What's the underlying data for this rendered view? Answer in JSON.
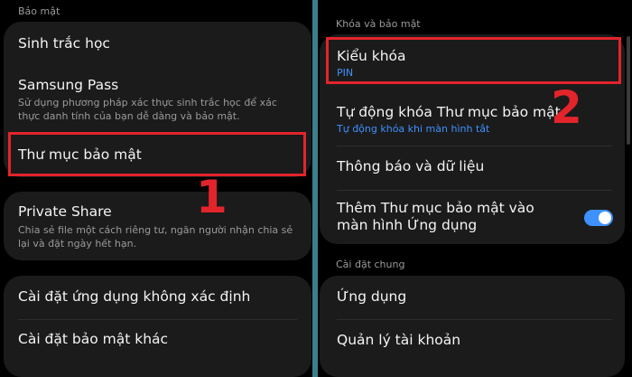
{
  "left": {
    "section_header": "Bảo mật",
    "items": {
      "biometrics": {
        "title": "Sinh trắc học"
      },
      "samsung_pass": {
        "title": "Samsung Pass",
        "description": "Sử dụng phương pháp xác thực sinh trắc học để xác thực danh tính của bạn dễ dàng và bảo mật."
      },
      "secure_folder": {
        "title": "Thư mục bảo mật"
      },
      "private_share": {
        "title": "Private Share",
        "description": "Chia sẻ file một cách riêng tư, ngăn người nhận chia sẻ lại và đặt ngày hết hạn."
      },
      "unknown_apps": {
        "title": "Cài đặt ứng dụng không xác định"
      },
      "other_security": {
        "title": "Cài đặt bảo mật khác"
      }
    },
    "step_label": "1"
  },
  "right": {
    "section_header_lock": "Khóa và bảo mật",
    "items": {
      "lock_type": {
        "title": "Kiểu khóa",
        "value": "PIN"
      },
      "auto_lock": {
        "title": "Tự động khóa Thư mục bảo mật",
        "value": "Tự động khóa khi màn hình tắt"
      },
      "notifications": {
        "title": "Thông báo và dữ liệu"
      },
      "add_to_apps": {
        "title": "Thêm Thư mục bảo mật vào màn hình Ứng dụng",
        "toggle_on": true
      }
    },
    "section_header_general": "Cài đặt chung",
    "general_items": {
      "apps": {
        "title": "Ứng dụng"
      },
      "accounts": {
        "title": "Quản lý tài khoản"
      }
    },
    "step_label": "2"
  },
  "colors": {
    "background": "#000000",
    "card": "#1b1b1b",
    "accent_blue": "#3e91ff",
    "highlight_red": "#e3242b",
    "divider_teal": "#3c7f8c"
  }
}
